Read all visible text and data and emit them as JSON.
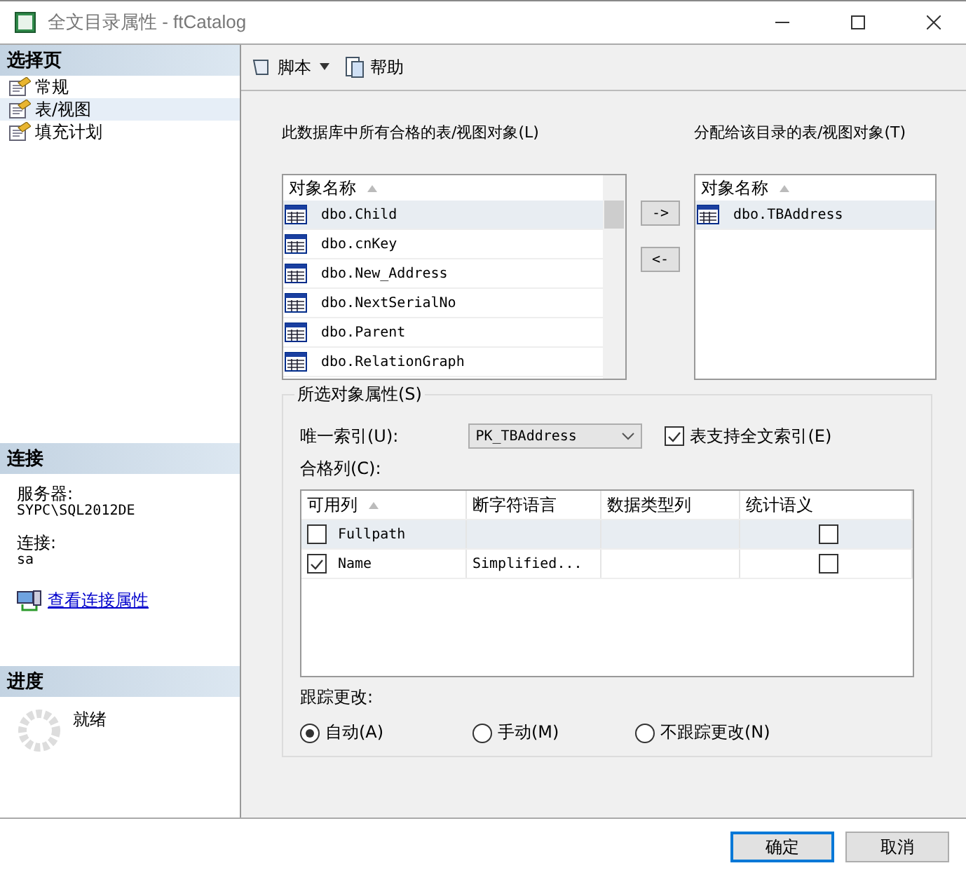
{
  "window": {
    "title": "全文目录属性 - ftCatalog"
  },
  "sidebar": {
    "header": "选择页",
    "items": [
      {
        "label": "常规",
        "selected": false
      },
      {
        "label": "表/视图",
        "selected": true
      },
      {
        "label": "填充计划",
        "selected": false
      }
    ],
    "connection": {
      "header": "连接",
      "server_label": "服务器:",
      "server": "SYPC\\SQL2012DE",
      "login_label": "连接:",
      "login": "sa",
      "link": "查看连接属性"
    },
    "progress": {
      "header": "进度",
      "status": "就绪"
    }
  },
  "toolbar": [
    {
      "label": "脚本",
      "kind": "dropdown"
    },
    {
      "label": "帮助",
      "kind": "plain"
    }
  ],
  "available": {
    "label": "此数据库中所有合格的表/视图对象(L)",
    "column": "对象名称",
    "items": [
      {
        "name": "dbo.Child",
        "selected": true
      },
      {
        "name": "dbo.cnKey",
        "selected": false
      },
      {
        "name": "dbo.New_Address",
        "selected": false
      },
      {
        "name": "dbo.NextSerialNo",
        "selected": false
      },
      {
        "name": "dbo.Parent",
        "selected": false
      },
      {
        "name": "dbo.RelationGraph",
        "selected": false
      }
    ]
  },
  "move_buttons": [
    "->",
    "<-"
  ],
  "assigned": {
    "label": "分配给该目录的表/视图对象(T)",
    "column": "对象名称",
    "items": [
      {
        "name": "dbo.TBAddress",
        "selected": true
      }
    ]
  },
  "properties": {
    "title": "所选对象属性(S)",
    "unique_index_label": "唯一索引(U):",
    "unique_index": "PK_TBAddress",
    "fulltext": {
      "label": "表支持全文索引(E)",
      "checked": true
    },
    "columns_label": "合格列(C):",
    "columns": [
      "可用列",
      "断字符语言",
      "数据类型列",
      "统计语义"
    ],
    "rows": [
      {
        "name": "Fullpath",
        "checked": false,
        "selected": true,
        "language": "",
        "semantics": false
      },
      {
        "name": "Name",
        "checked": true,
        "selected": false,
        "language": "Simplified...",
        "semantics": false
      }
    ],
    "track_label": "跟踪更改:",
    "track_options": [
      {
        "label": "自动(A)",
        "selected": true
      },
      {
        "label": "手动(M)",
        "selected": false
      },
      {
        "label": "不跟踪更改(N)",
        "selected": false
      }
    ]
  },
  "buttons": [
    "确定",
    "取消"
  ]
}
